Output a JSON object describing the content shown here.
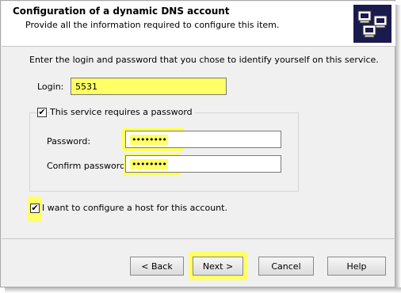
{
  "header": {
    "title": "Configuration of a dynamic DNS account",
    "subtitle": "Provide all the information required to configure this item.",
    "logo_icon": "network-computers-icon"
  },
  "body": {
    "intro": "Enter the login and password that you chose to identify yourself on this service.",
    "login_label": "Login:",
    "login_value": "5531",
    "password_required_label": "This service requires a password",
    "password_required_checked": true,
    "password_label": "Password:",
    "password_value": "••••••••",
    "confirm_label": "Confirm password:",
    "confirm_value": "••••••••",
    "host_label": "I want to configure a host for this account.",
    "host_checked": true
  },
  "buttons": {
    "back": "< Back",
    "next": "Next >",
    "cancel": "Cancel",
    "help": "Help"
  },
  "colors": {
    "highlight": "#ffff66",
    "logo_bg": "#1a1a4e"
  }
}
